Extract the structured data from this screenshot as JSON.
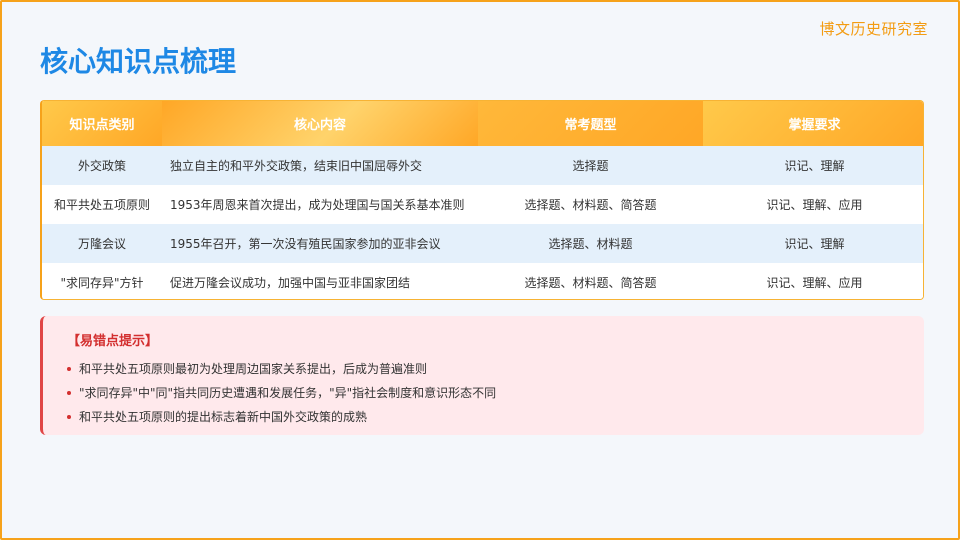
{
  "brand": "博文历史研究室",
  "title": "核心知识点梳理",
  "table": {
    "headers": [
      "知识点类别",
      "核心内容",
      "常考题型",
      "掌握要求"
    ],
    "rows": [
      [
        "外交政策",
        "独立自主的和平外交政策，结束旧中国屈辱外交",
        "选择题",
        "识记、理解"
      ],
      [
        "和平共处五项原则",
        "1953年周恩来首次提出，成为处理国与国关系基本准则",
        "选择题、材料题、简答题",
        "识记、理解、应用"
      ],
      [
        "万隆会议",
        "1955年召开，第一次没有殖民国家参加的亚非会议",
        "选择题、材料题",
        "识记、理解"
      ],
      [
        "\"求同存异\"方针",
        "促进万隆会议成功，加强中国与亚非国家团结",
        "选择题、材料题、简答题",
        "识记、理解、应用"
      ]
    ]
  },
  "note": {
    "title": "【易错点提示】",
    "items": [
      "和平共处五项原则最初为处理周边国家关系提出，后成为普遍准则",
      "\"求同存异\"中\"同\"指共同历史遭遇和发展任务，\"异\"指社会制度和意识形态不同",
      "和平共处五项原则的提出标志着新中国外交政策的成熟"
    ]
  },
  "colors": {
    "accent_blue": "#1e88e5",
    "accent_orange": "#ffa726",
    "warning_red": "#d32f2f"
  }
}
